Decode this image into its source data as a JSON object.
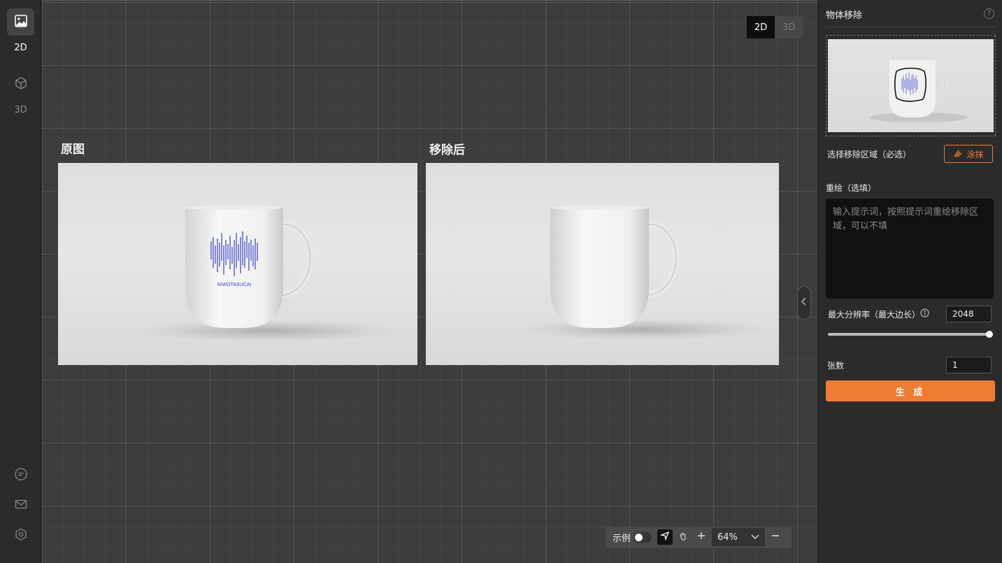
{
  "rail": {
    "items": [
      {
        "label": "2D",
        "icon": "image-icon",
        "active": true
      },
      {
        "label": "3D",
        "icon": "cube-icon",
        "active": false
      }
    ],
    "footer_icons": [
      "chat-icon",
      "mail-icon",
      "settings-icon"
    ]
  },
  "canvas": {
    "mode_toggle": {
      "option_2d": "2D",
      "option_3d": "3D",
      "selected": "2D"
    },
    "images": [
      {
        "title": "原图"
      },
      {
        "title": "移除后"
      }
    ],
    "mug_logo_text": "NIWOTASUCAI",
    "toolbar": {
      "example_label": "示例",
      "example_toggle_on": false,
      "zoom_value": "64%"
    }
  },
  "panel": {
    "title": "物体移除",
    "select_area_label": "选择移除区域（必选）",
    "smear_button_label": "涂抹",
    "redraw_label": "重绘（选填）",
    "prompt_value": "",
    "prompt_placeholder": "输入提示词，按照提示词重绘移除区域，可以不填",
    "max_resolution_label": "最大分辨率（最大边长）",
    "max_resolution_value": "2048",
    "resolution_slider_fraction": 1.0,
    "count_label": "张数",
    "count_value": "1",
    "generate_button_label": "生 成"
  },
  "colors": {
    "accent": "#ef7c33",
    "logo_blue": "#3440c0"
  }
}
